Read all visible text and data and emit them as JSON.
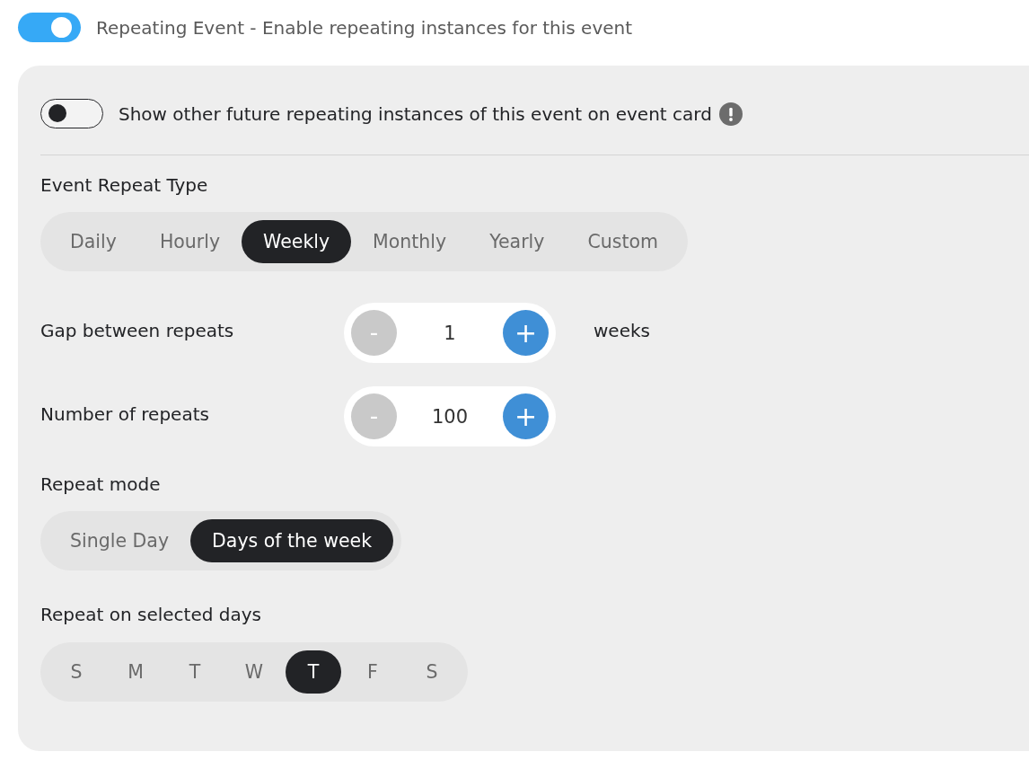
{
  "repeating_event": {
    "label": "Repeating Event - Enable repeating instances for this event",
    "on": true
  },
  "options_panel": {
    "show_future_instances": {
      "label": "Show other future repeating instances of this event on event card",
      "on": false
    },
    "repeat_type": {
      "label": "Event Repeat Type",
      "options": [
        {
          "label": "Daily",
          "selected": false
        },
        {
          "label": "Hourly",
          "selected": false
        },
        {
          "label": "Weekly",
          "selected": true
        },
        {
          "label": "Monthly",
          "selected": false
        },
        {
          "label": "Yearly",
          "selected": false
        },
        {
          "label": "Custom",
          "selected": false
        }
      ]
    },
    "steppers": [
      {
        "label": "Gap between repeats",
        "decrement": "-",
        "value": "1",
        "increment": "+",
        "unit": "weeks"
      },
      {
        "label": "Number of repeats",
        "decrement": "-",
        "value": "100",
        "increment": "+"
      }
    ],
    "repeat_mode": {
      "label": "Repeat mode",
      "options": [
        {
          "label": "Single Day",
          "selected": false
        },
        {
          "label": "Days of the week",
          "selected": true
        }
      ]
    },
    "repeat_days": {
      "label": "Repeat on selected days",
      "days": [
        {
          "label": "S",
          "selected": false
        },
        {
          "label": "M",
          "selected": false
        },
        {
          "label": "T",
          "selected": false
        },
        {
          "label": "W",
          "selected": false
        },
        {
          "label": "T",
          "selected": true
        },
        {
          "label": "F",
          "selected": false
        },
        {
          "label": "S",
          "selected": false
        }
      ]
    }
  }
}
